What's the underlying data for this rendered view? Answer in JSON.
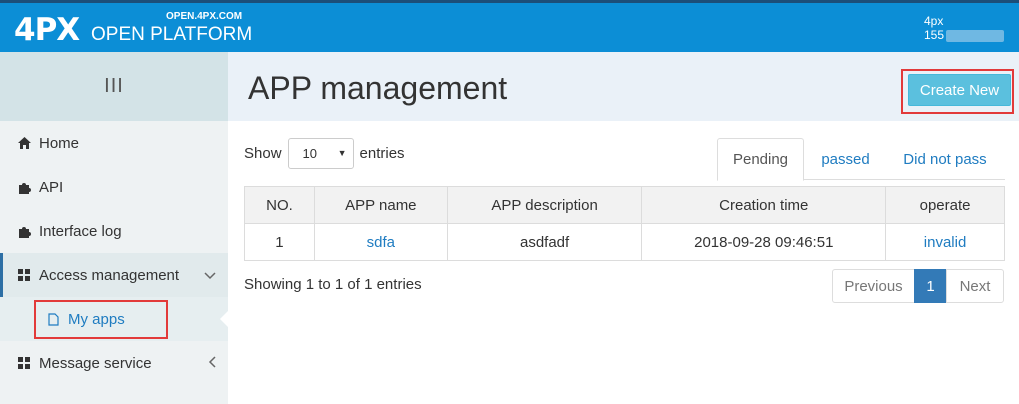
{
  "topbar": {
    "logo_mark": "4PX",
    "logo_domain": "OPEN.4PX.COM",
    "logo_name": "OPEN PLATFORM",
    "user_line1": "4px",
    "user_line2": "155"
  },
  "sidebar": {
    "toggle_icon": "III",
    "items": [
      {
        "label": "Home",
        "icon": "home-icon"
      },
      {
        "label": "API",
        "icon": "puzzle-icon"
      },
      {
        "label": "Interface log",
        "icon": "puzzle-icon"
      },
      {
        "label": "Access management",
        "icon": "grid-icon",
        "expanded": true
      },
      {
        "label": "My apps",
        "icon": "file-icon",
        "active": true
      },
      {
        "label": "Message service",
        "icon": "grid-icon"
      }
    ]
  },
  "header": {
    "title": "APP management",
    "create_label": "Create New"
  },
  "controls": {
    "show_label": "Show",
    "page_size": "10",
    "entries_label": "entries"
  },
  "tabs": [
    {
      "label": "Pending",
      "active": true
    },
    {
      "label": "passed"
    },
    {
      "label": "Did not pass"
    }
  ],
  "table": {
    "columns": [
      "NO.",
      "APP name",
      "APP description",
      "Creation time",
      "operate"
    ],
    "rows": [
      [
        "1",
        "sdfa",
        "asdfadf",
        "2018-09-28 09:46:51",
        "invalid"
      ]
    ]
  },
  "footer": {
    "info": "Showing 1 to 1 of 1 entries",
    "prev": "Previous",
    "page": "1",
    "next": "Next"
  },
  "colors": {
    "topbar": "#0c8ed6",
    "accent_button": "#5bc0de",
    "link": "#1f7cc1",
    "highlight_box": "#e23a3a"
  }
}
